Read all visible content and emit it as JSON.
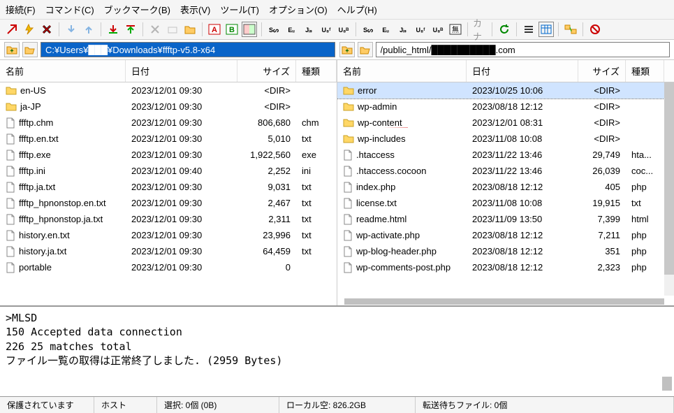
{
  "menu": [
    "接続(F)",
    "コマンド(C)",
    "ブックマーク(B)",
    "表示(V)",
    "ツール(T)",
    "オプション(O)",
    "ヘルプ(H)"
  ],
  "local_path": "C:¥Users¥███¥Downloads¥ffftp-v5.8-x64",
  "remote_path": "/public_html/██████████.com",
  "cols": {
    "name": "名前",
    "date": "日付",
    "size": "サイズ",
    "type": "種類"
  },
  "local": [
    {
      "n": "en-US",
      "d": "2023/12/01 09:30",
      "s": "<DIR>",
      "t": "",
      "dir": true
    },
    {
      "n": "ja-JP",
      "d": "2023/12/01 09:30",
      "s": "<DIR>",
      "t": "",
      "dir": true
    },
    {
      "n": "ffftp.chm",
      "d": "2023/12/01 09:30",
      "s": "806,680",
      "t": "chm",
      "dir": false
    },
    {
      "n": "ffftp.en.txt",
      "d": "2023/12/01 09:30",
      "s": "5,010",
      "t": "txt",
      "dir": false
    },
    {
      "n": "ffftp.exe",
      "d": "2023/12/01 09:30",
      "s": "1,922,560",
      "t": "exe",
      "dir": false
    },
    {
      "n": "ffftp.ini",
      "d": "2023/12/01 09:40",
      "s": "2,252",
      "t": "ini",
      "dir": false
    },
    {
      "n": "ffftp.ja.txt",
      "d": "2023/12/01 09:30",
      "s": "9,031",
      "t": "txt",
      "dir": false
    },
    {
      "n": "ffftp_hpnonstop.en.txt",
      "d": "2023/12/01 09:30",
      "s": "2,467",
      "t": "txt",
      "dir": false
    },
    {
      "n": "ffftp_hpnonstop.ja.txt",
      "d": "2023/12/01 09:30",
      "s": "2,311",
      "t": "txt",
      "dir": false
    },
    {
      "n": "history.en.txt",
      "d": "2023/12/01 09:30",
      "s": "23,996",
      "t": "txt",
      "dir": false
    },
    {
      "n": "history.ja.txt",
      "d": "2023/12/01 09:30",
      "s": "64,459",
      "t": "txt",
      "dir": false
    },
    {
      "n": "portable",
      "d": "2023/12/01 09:30",
      "s": "0",
      "t": "",
      "dir": false
    }
  ],
  "remote": [
    {
      "n": "error",
      "d": "2023/10/25 10:06",
      "s": "<DIR>",
      "t": "",
      "dir": true,
      "sel": true
    },
    {
      "n": "wp-admin",
      "d": "2023/08/18 12:12",
      "s": "<DIR>",
      "t": "",
      "dir": true
    },
    {
      "n": "wp-content",
      "d": "2023/12/01 08:31",
      "s": "<DIR>",
      "t": "",
      "dir": true,
      "mark": true
    },
    {
      "n": "wp-includes",
      "d": "2023/11/08 10:08",
      "s": "<DIR>",
      "t": "",
      "dir": true
    },
    {
      "n": ".htaccess",
      "d": "2023/11/22 13:46",
      "s": "29,749",
      "t": "hta...",
      "dir": false
    },
    {
      "n": ".htaccess.cocoon",
      "d": "2023/11/22 13:46",
      "s": "26,039",
      "t": "coc...",
      "dir": false
    },
    {
      "n": "index.php",
      "d": "2023/08/18 12:12",
      "s": "405",
      "t": "php",
      "dir": false
    },
    {
      "n": "license.txt",
      "d": "2023/11/08 10:08",
      "s": "19,915",
      "t": "txt",
      "dir": false
    },
    {
      "n": "readme.html",
      "d": "2023/11/09 13:50",
      "s": "7,399",
      "t": "html",
      "dir": false
    },
    {
      "n": "wp-activate.php",
      "d": "2023/08/18 12:12",
      "s": "7,211",
      "t": "php",
      "dir": false
    },
    {
      "n": "wp-blog-header.php",
      "d": "2023/08/18 12:12",
      "s": "351",
      "t": "php",
      "dir": false
    },
    {
      "n": "wp-comments-post.php",
      "d": "2023/08/18 12:12",
      "s": "2,323",
      "t": "php",
      "dir": false
    }
  ],
  "log": [
    ">MLSD",
    "150 Accepted data connection",
    "226 25 matches total",
    "ファイル一覧の取得は正常終了しました. (2959 Bytes)"
  ],
  "status": {
    "sec": "保護されています",
    "host": "ホスト",
    "sel": "選択: 0個 (0B)",
    "disk": "ローカル空: 826.2GB",
    "queue": "転送待ちファイル: 0個"
  }
}
